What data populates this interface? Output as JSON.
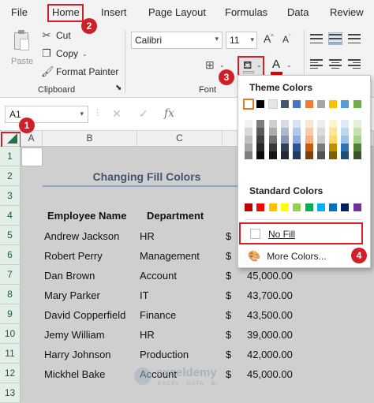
{
  "menu": {
    "items": [
      "File",
      "Home",
      "Insert",
      "Page Layout",
      "Formulas",
      "Data",
      "Review"
    ]
  },
  "ribbon": {
    "clipboard": {
      "paste_label": "Paste",
      "cut_label": "Cut",
      "copy_label": "Copy",
      "format_painter_label": "Format Painter",
      "group_label": "Clipboard"
    },
    "font": {
      "font_name": "Calibri",
      "font_size": "11",
      "group_label": "Font",
      "font_color": "#e00000"
    }
  },
  "formula_bar": {
    "name_box": "A1",
    "function_icon": "fx"
  },
  "sheet": {
    "columns": [
      "A",
      "B",
      "C"
    ],
    "rows": [
      "1",
      "2",
      "3",
      "4",
      "5",
      "6",
      "7",
      "8",
      "9",
      "10",
      "11",
      "12",
      "13"
    ],
    "title": "Changing Fill Colors",
    "headers": {
      "name": "Employee Name",
      "dept": "Department"
    },
    "employees": [
      {
        "name": "Andrew Jackson",
        "dept": "HR",
        "cur": "$",
        "salary": ""
      },
      {
        "name": "Robert Perry",
        "dept": "Management",
        "cur": "$",
        "salary": ""
      },
      {
        "name": "Dan Brown",
        "dept": "Account",
        "cur": "$",
        "salary": "45,000.00"
      },
      {
        "name": "Mary Parker",
        "dept": "IT",
        "cur": "$",
        "salary": "43,700.00"
      },
      {
        "name": "David Copperfield",
        "dept": "Finance",
        "cur": "$",
        "salary": "43,500.00"
      },
      {
        "name": "Jemy William",
        "dept": "HR",
        "cur": "$",
        "salary": "39,000.00"
      },
      {
        "name": "Harry Johnson",
        "dept": "Production",
        "cur": "$",
        "salary": "42,000.00"
      },
      {
        "name": "Mickhel Bake",
        "dept": "Account",
        "cur": "$",
        "salary": "45,000.00"
      }
    ]
  },
  "fill_dropdown": {
    "theme_heading": "Theme Colors",
    "standard_heading": "Standard Colors",
    "no_fill_label": "No Fill",
    "more_colors_label": "More Colors...",
    "theme_top": [
      "#ffffff",
      "#000000",
      "#e7e6e6",
      "#44546a",
      "#4472c4",
      "#ed7d31",
      "#a5a5a5",
      "#ffc000",
      "#5b9bd5",
      "#70ad47"
    ],
    "theme_shades": [
      [
        "#f2f2f2",
        "#7f7f7f",
        "#d0cece",
        "#d6dce4",
        "#d9e2f3",
        "#fbe5d5",
        "#ededed",
        "#fff2cc",
        "#deebf6",
        "#e2efd9"
      ],
      [
        "#d8d8d8",
        "#595959",
        "#aeabab",
        "#adb9ca",
        "#b4c6e7",
        "#f7cbac",
        "#dbdbdb",
        "#fee599",
        "#bdd7ee",
        "#c5e0b3"
      ],
      [
        "#bfbfbf",
        "#3f3f3f",
        "#757070",
        "#8496b0",
        "#8eaadb",
        "#f4b183",
        "#c9c9c9",
        "#ffd965",
        "#9cc3e5",
        "#a8d08d"
      ],
      [
        "#a5a5a5",
        "#262626",
        "#3a3838",
        "#323f4f",
        "#2f5496",
        "#c55a11",
        "#7b7b7b",
        "#bf9000",
        "#2e75b5",
        "#538135"
      ],
      [
        "#7f7f7f",
        "#0c0c0c",
        "#171616",
        "#222a35",
        "#1f3864",
        "#833c0b",
        "#525252",
        "#7f6000",
        "#1e4e79",
        "#375623"
      ]
    ],
    "standard": [
      "#c00000",
      "#ff0000",
      "#ffc000",
      "#ffff00",
      "#92d050",
      "#00b050",
      "#00b0f0",
      "#0070c0",
      "#002060",
      "#7030a0"
    ]
  },
  "badges": [
    "1",
    "2",
    "3",
    "4"
  ],
  "watermark": {
    "name": "exceldemy",
    "tagline": "EXCEL · DATA · BI"
  },
  "colors": {
    "accent_red": "#d11f2a",
    "excel_green": "#217346"
  }
}
